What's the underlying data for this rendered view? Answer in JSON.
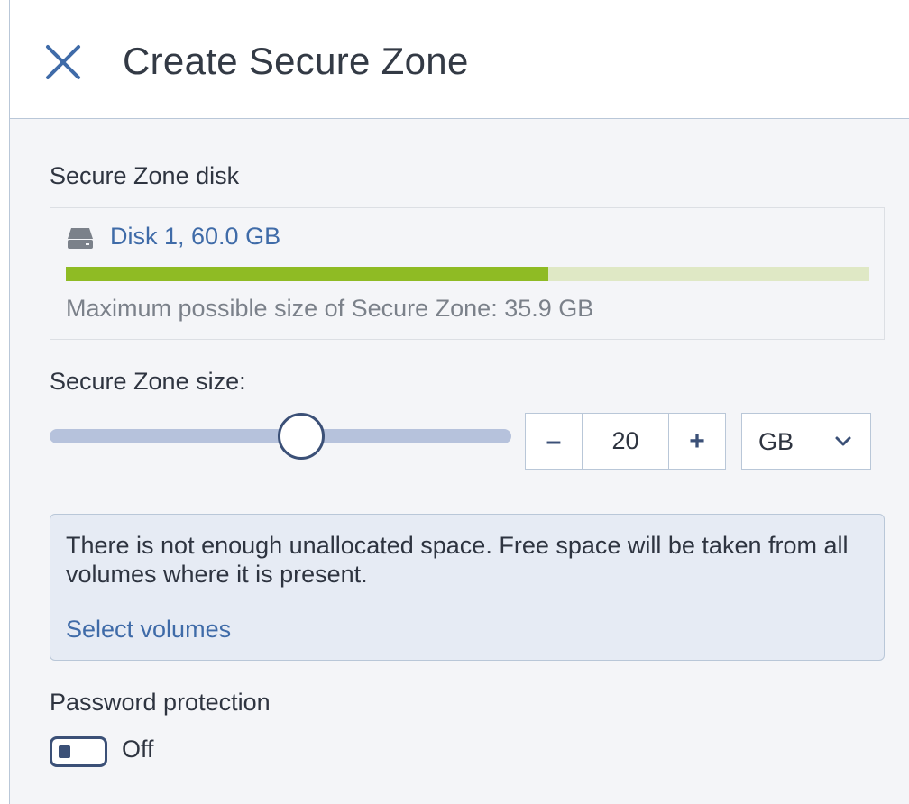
{
  "header": {
    "title": "Create Secure Zone",
    "close_icon": "close-icon"
  },
  "disk_section": {
    "label": "Secure Zone disk",
    "disk_icon": "hard-drive-icon",
    "disk_name": "Disk 1, 60.0 GB",
    "usage_fraction": 0.6,
    "max_size_text": "Maximum possible size of Secure Zone: 35.9 GB",
    "colors": {
      "used": "#8fbb24",
      "free": "#dfe8c5",
      "link": "#3f6ba8"
    }
  },
  "size_section": {
    "label": "Secure Zone size:",
    "slider_fraction": 0.545,
    "minus_label": "–",
    "value": "20",
    "plus_label": "+",
    "unit": "GB",
    "unit_icon": "chevron-down-icon"
  },
  "warning": {
    "text": "There is not enough unallocated space. Free space will be taken from all volumes where it is present.",
    "link": "Select volumes"
  },
  "password": {
    "label": "Password protection",
    "toggle_state": "Off"
  }
}
